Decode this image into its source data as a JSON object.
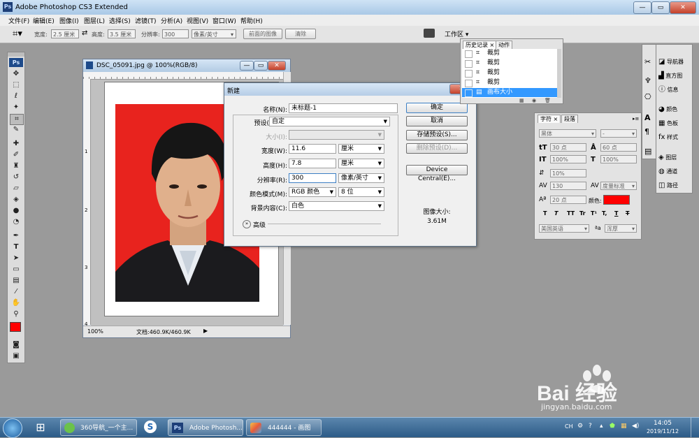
{
  "window": {
    "title": "Adobe Photoshop CS3 Extended",
    "app_badge": "Ps"
  },
  "menu": [
    "文件(F)",
    "编辑(E)",
    "图像(I)",
    "图层(L)",
    "选择(S)",
    "滤镜(T)",
    "分析(A)",
    "视图(V)",
    "窗口(W)",
    "帮助(H)"
  ],
  "options": {
    "width_label": "宽度:",
    "width_value": "2.5 厘米",
    "height_label": "高度:",
    "height_value": "3.5 厘米",
    "res_label": "分辨率:",
    "res_value": "300",
    "res_unit": "像素/英寸",
    "front_image": "前面的图像",
    "clear": "清除",
    "workspace": "工作区 ▾"
  },
  "document": {
    "title": "DSC_05091.jpg @ 100%(RGB/8)",
    "zoom": "100%",
    "doc_info": "文档:460.9K/460.9K",
    "ruler_v": [
      "1",
      "2",
      "3",
      "4"
    ]
  },
  "dialog": {
    "title": "新建",
    "name_label": "名称(N):",
    "name_value": "未标题-1",
    "preset_label": "预设(P):",
    "preset_value": "自定",
    "size_label": "大小(I):",
    "width_label": "宽度(W):",
    "width_value": "11.6",
    "width_unit": "厘米",
    "height_label": "高度(H):",
    "height_value": "7.8",
    "height_unit": "厘米",
    "res_label": "分辨率(R):",
    "res_value": "300",
    "res_unit": "像素/英寸",
    "mode_label": "颜色模式(M):",
    "mode_value": "RGB 颜色",
    "depth_value": "8 位",
    "bg_label": "背景内容(C):",
    "bg_value": "白色",
    "advanced": "高级",
    "ok": "确定",
    "cancel": "取消",
    "save_preset": "存储预设(S)...",
    "delete_preset": "删除预设(D)...",
    "device_central": "Device Central(E)...",
    "image_size_label": "图像大小:",
    "image_size_value": "3.61M"
  },
  "history": {
    "tabs": [
      "历史记录 ×",
      "动作"
    ],
    "items": [
      "裁剪",
      "裁剪",
      "裁剪",
      "裁剪",
      "画布大小"
    ]
  },
  "character": {
    "tabs": [
      "字符 ×",
      "段落"
    ],
    "font_family": "黑体",
    "font_style": "-",
    "size": "30 点",
    "leading": "60 点",
    "vscale": "100%",
    "hscale": "100%",
    "baseline_pct": "10%",
    "tracking": "130",
    "kerning": "度量标准",
    "shift": "20 点",
    "color_label": "颜色:",
    "language": "美国英语",
    "aa": "浑厚",
    "styles": [
      "T",
      "T",
      "TT",
      "Tr",
      "T¹",
      "T,",
      "T",
      "T"
    ]
  },
  "right_panel": [
    "导航器",
    "直方图",
    "信息",
    "颜色",
    "色板",
    "样式",
    "图层",
    "通道",
    "路径"
  ],
  "taskbar": {
    "items": [
      "360导航_一个主...",
      "Adobe Photosh...",
      "444444 - 画图"
    ],
    "lang": "CH",
    "time": "14:05",
    "date": "2019/11/12"
  },
  "watermark": {
    "brand": "Bai 经验",
    "url": "jingyan.baidu.com"
  },
  "colors": {
    "accent": "#3399ff",
    "foreground_swatch": "#ff0000",
    "photo_bg": "#e8231e"
  }
}
